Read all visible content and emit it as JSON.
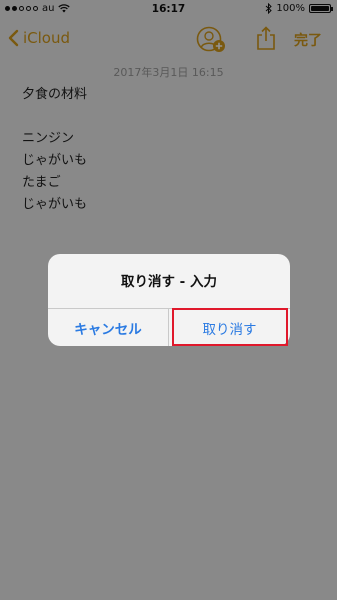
{
  "status_bar": {
    "carrier": "au",
    "time": "16:17",
    "battery": "100%"
  },
  "nav": {
    "back_label": "iCloud",
    "done_label": "完了",
    "icons": [
      "back-chevron-icon",
      "add-person-icon",
      "share-icon"
    ]
  },
  "note": {
    "date": "2017年3月1日 16:15",
    "lines": [
      "夕食の材料",
      "",
      "ニンジン",
      "じゃがいも",
      "たまご",
      "じゃがいも"
    ]
  },
  "alert": {
    "title": "取り消す - 入力",
    "cancel_label": "キャンセル",
    "undo_label": "取り消す"
  },
  "colors": {
    "accent": "#d39a1a",
    "alert_button": "#2a7ae2",
    "highlight": "#e0182b"
  }
}
